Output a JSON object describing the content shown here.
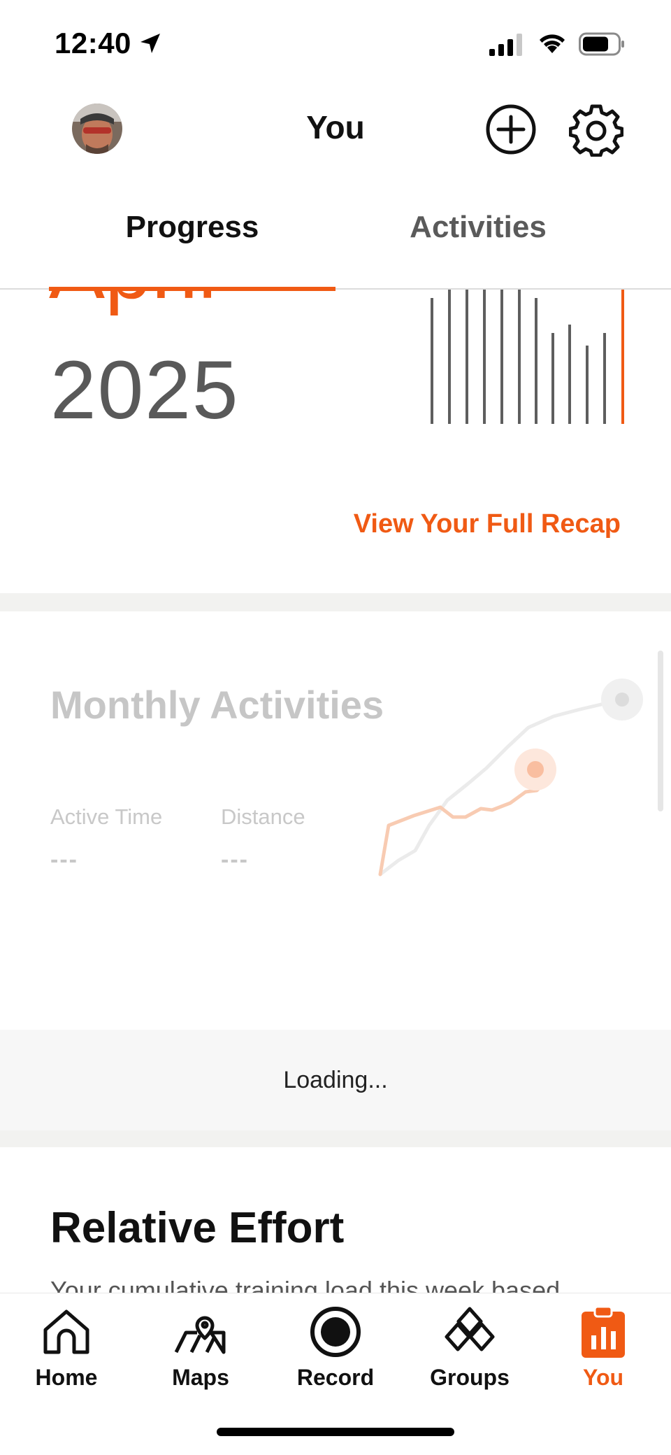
{
  "status_bar": {
    "time": "12:40"
  },
  "header": {
    "title": "You"
  },
  "tabs": [
    {
      "label": "Progress",
      "active": true
    },
    {
      "label": "Activities",
      "active": false
    }
  ],
  "recap": {
    "month": "April",
    "year": "2025",
    "link_label": "View Your Full Recap"
  },
  "monthly": {
    "title": "Monthly Activities",
    "stats": [
      {
        "label": "Active Time",
        "value": "---"
      },
      {
        "label": "Distance",
        "value": "---"
      }
    ],
    "loading_text": "Loading..."
  },
  "relative_effort": {
    "title": "Relative Effort",
    "subtitle": "Your cumulative training load this week based"
  },
  "nav": [
    {
      "label": "Home",
      "icon": "home-icon"
    },
    {
      "label": "Maps",
      "icon": "maps-icon"
    },
    {
      "label": "Record",
      "icon": "record-icon"
    },
    {
      "label": "Groups",
      "icon": "groups-icon"
    },
    {
      "label": "You",
      "icon": "you-icon",
      "active": true
    }
  ],
  "colors": {
    "accent": "#f05a14",
    "muted": "#c6c6c6"
  }
}
